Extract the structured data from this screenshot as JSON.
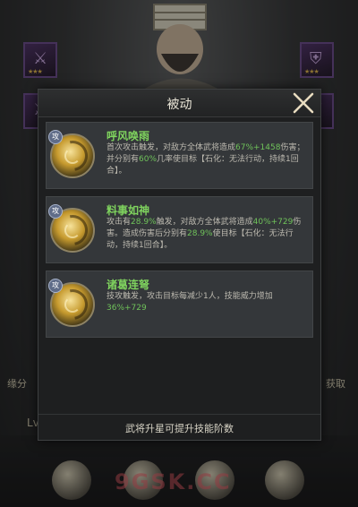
{
  "modal": {
    "title": "被动",
    "close_icon": "close-icon",
    "footer_note": "武将升星可提升技能阶数"
  },
  "skills": [
    {
      "name": "呼风唤雨",
      "desc_parts": [
        "首次攻击触发，对敌方全体武将造成",
        "67%+1458",
        "伤害；并分别有",
        "60%",
        "几率使目标【石化：无法行动，持续1回合】。"
      ],
      "level_badge": "攻"
    },
    {
      "name": "料事如神",
      "desc_parts": [
        "攻击有",
        "28.9%",
        "触发，对敌方全体武将造成",
        "40%+729",
        "伤害。造成伤害后分别有",
        "28.9%",
        "使目标【石化：无法行动，持续1回合】。"
      ],
      "level_badge": "攻"
    },
    {
      "name": "诸葛连弩",
      "desc_parts": [
        "技攻触发，攻击目标每减少1人，技能威力增加",
        "36%+729",
        ""
      ],
      "level_badge": "攻"
    }
  ],
  "background": {
    "left_tag": "缘分",
    "right_tag": "获取",
    "lv_label": "Lv",
    "watermark": "9GSK.CC"
  },
  "colors": {
    "highlight": "#6fc25a",
    "skill_name": "#7fd35e",
    "panel": "#1e1f20",
    "card": "#34373a"
  }
}
